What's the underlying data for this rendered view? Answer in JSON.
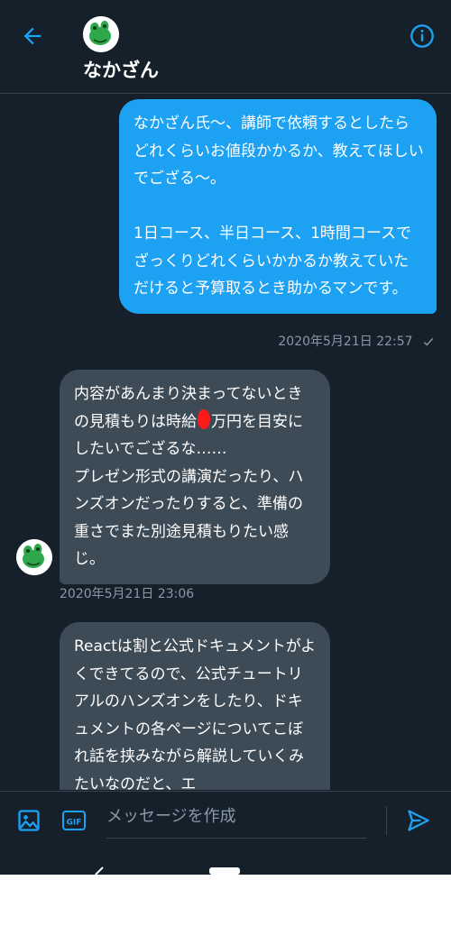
{
  "header": {
    "name": "なかざん"
  },
  "messages": {
    "outgoing": {
      "text": "なかざん氏〜、講師で依頼するとしたらどれくらいお値段かかるか、教えてほしいでござる〜。\n\n1日コース、半日コース、1時間コースでざっくりどれくらいかかるか教えていただけると予算取るとき助かるマンです。",
      "time": "2020年5月21日 22:57"
    },
    "incoming1": {
      "text_before": "内容があんまり決まってないときの見積もりは時給",
      "text_after": "万円を目安にしたいでござるな……\nプレゼン形式の講演だったり、ハンズオンだったりすると、準備の重さでまた別途見積もりたい感じ。",
      "time": "2020年5月21日 23:06"
    },
    "incoming2": {
      "text": "Reactは割と公式ドキュメントがよくできてるので、公式チュートリアルのハンズオンをしたり、ドキュメントの各ページについてこぼれ話を挟みながら解説していくみたいなのだと、エ"
    }
  },
  "composer": {
    "placeholder": "メッセージを作成",
    "gif_label": "GIF"
  },
  "colors": {
    "background": "#15202b",
    "accent": "#1da1f2",
    "incoming_bubble": "#3d4b57",
    "muted": "#8899a6"
  }
}
